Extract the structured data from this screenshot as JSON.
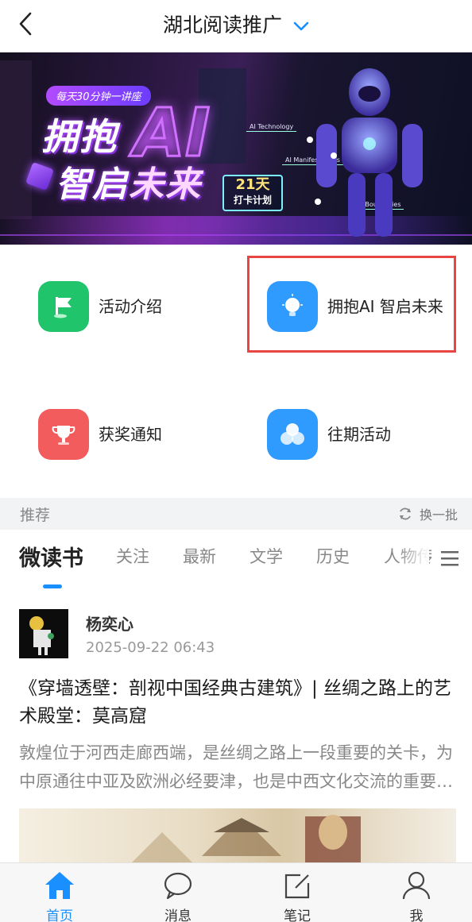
{
  "header": {
    "title": "湖北阅读推广"
  },
  "banner": {
    "pill": "每天30分钟一讲座",
    "line1": "拥抱",
    "ai": "AI",
    "line2a": "智启",
    "line2b": "未来",
    "days_num": "21天",
    "days_text": "打卡计划",
    "tag1": "AI Technology",
    "tag2": "AI Manifestations",
    "tag3": "AI Boundaries"
  },
  "menu": {
    "activity_intro": "活动介绍",
    "embrace_ai": "拥抱AI 智启未来",
    "award_notice": "获奖通知",
    "past_events": "往期活动"
  },
  "recommend": {
    "label": "推荐",
    "refresh": "换一批"
  },
  "tabs": [
    "微读书",
    "关注",
    "最新",
    "文学",
    "历史",
    "人物传"
  ],
  "post": {
    "author": "杨奕心",
    "time": "2025-09-22 06:43",
    "title": "《穿墙透壁：剖视中国经典古建筑》| 丝绸之路上的艺术殿堂：莫高窟",
    "desc": "敦煌位于河西走廊西端，是丝绸之路上一段重要的关卡，为中原通往中亚及欧洲必经要津，也是中西文化交流的重要枢纽。"
  },
  "nav": {
    "home": "首页",
    "messages": "消息",
    "notes": "笔记",
    "me": "我"
  },
  "colors": {
    "accent": "#1a8fff",
    "green": "#1fc46b",
    "blue": "#2f9bff",
    "red": "#f25c5c",
    "highlight": "#e84545"
  }
}
